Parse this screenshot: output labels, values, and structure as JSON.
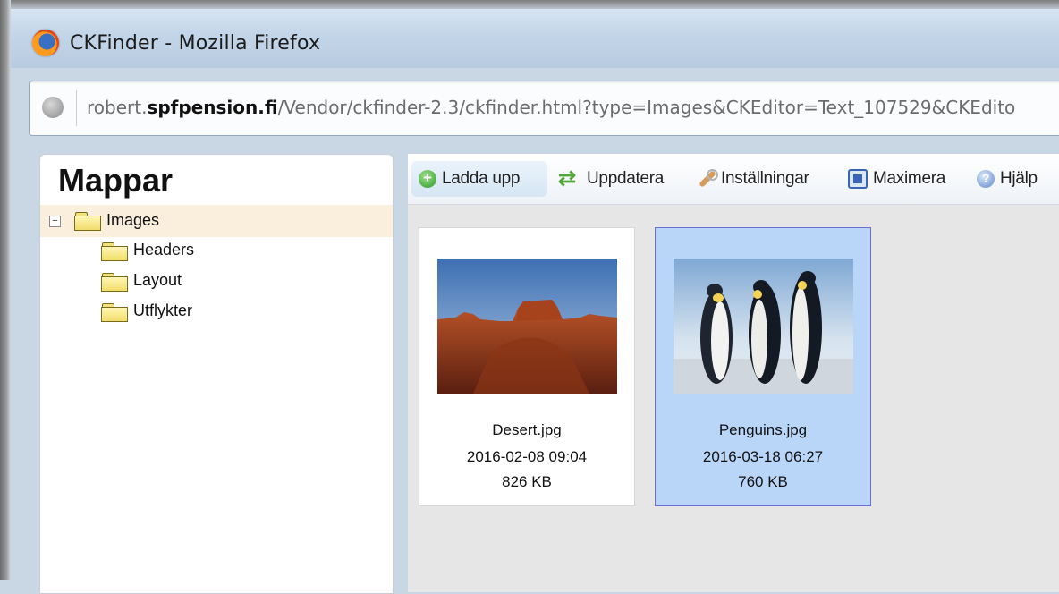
{
  "window": {
    "title": "CKFinder - Mozilla Firefox"
  },
  "urlbar": {
    "prefix": "robert.",
    "domain": "spfpension.fi",
    "path": "/Vendor/ckfinder-2.3/ckfinder.html?type=Images&CKEditor=Text_107529&CKEdito"
  },
  "folders": {
    "heading": "Mappar",
    "root": {
      "label": "Images",
      "expanded": true
    },
    "children": [
      {
        "label": "Headers"
      },
      {
        "label": "Layout"
      },
      {
        "label": "Utflykter"
      }
    ]
  },
  "toolbar": {
    "upload": "Ladda upp",
    "refresh": "Uppdatera",
    "settings": "Inställningar",
    "maximize": "Maximera",
    "help": "Hjälp"
  },
  "files": [
    {
      "name": "Desert.jpg",
      "date": "2016-02-08 09:04",
      "size": "826 KB",
      "selected": false,
      "thumb_icon": "desert-photo"
    },
    {
      "name": "Penguins.jpg",
      "date": "2016-03-18 06:27",
      "size": "760 KB",
      "selected": true,
      "thumb_icon": "penguins-photo"
    }
  ],
  "colors": {
    "selection_bg": "#b9d6f8",
    "selection_border": "#6f6fd2",
    "tree_root_bg": "#faeedd"
  }
}
